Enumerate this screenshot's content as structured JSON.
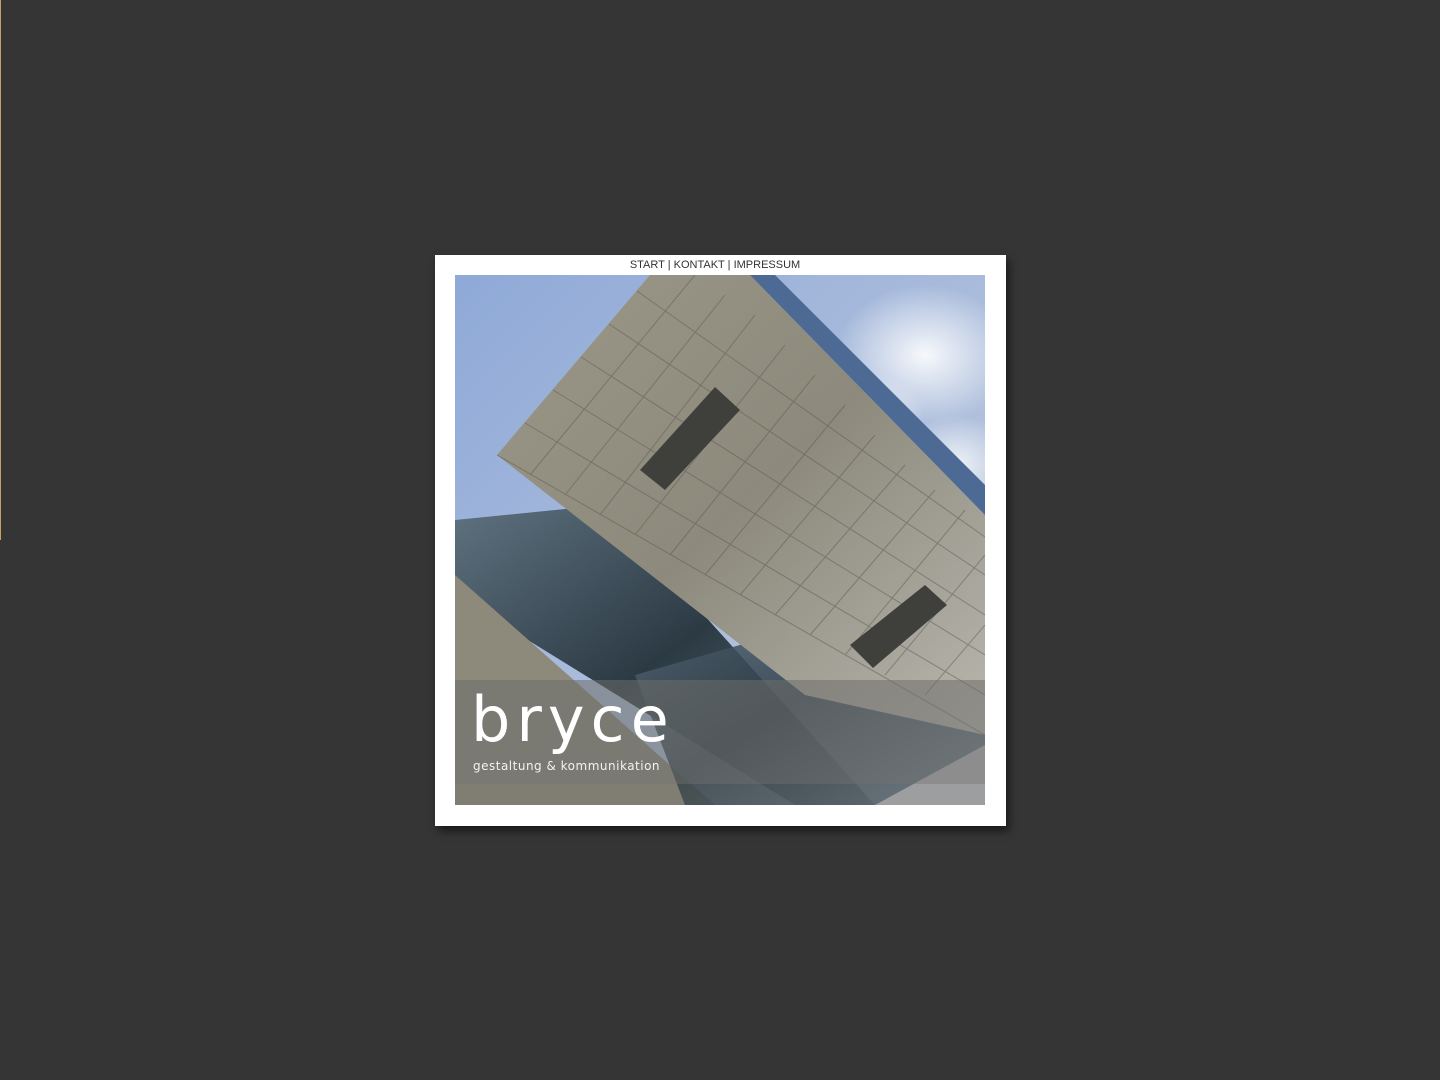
{
  "nav": {
    "items": [
      {
        "label": "START"
      },
      {
        "label": "KONTAKT"
      },
      {
        "label": "IMPRESSUM"
      }
    ],
    "separator": "|"
  },
  "logo": {
    "name": "bryce",
    "tagline": "gestaltung & kommunikation"
  },
  "colors": {
    "page_background": "#353535",
    "frame_background": "#ffffff",
    "nav_text": "#333333",
    "accent_edge": "#c8a060"
  },
  "hero_image": {
    "subject": "building-facade-photo"
  }
}
